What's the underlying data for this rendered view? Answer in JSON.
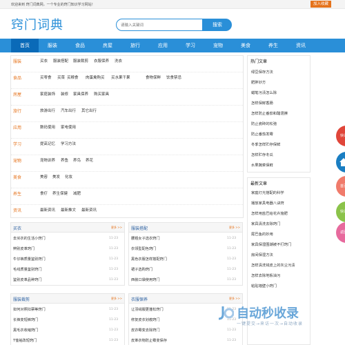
{
  "topbar": {
    "welcome": "欢迎来到 窍门词典网，一个专业的窍门知识学习网站！",
    "favorite": "加入收藏"
  },
  "logo": "窍门词典",
  "search": {
    "placeholder": "请输入关键词",
    "button": "搜索"
  },
  "nav": [
    "首页",
    "服装",
    "食品",
    "房屋",
    "旅行",
    "应用",
    "学习",
    "宠物",
    "美食",
    "养生",
    "资讯"
  ],
  "categories": [
    {
      "name": "服装",
      "items": [
        "买衣",
        "服装搭配",
        "服装裁剪",
        "衣服保养",
        "洗衣"
      ]
    },
    {
      "name": "食品",
      "items": [
        "买零食",
        "买菜",
        "买粮食",
        "肉蛋禽购买",
        "买水果干果",
        "食物保鲜",
        "饮食禁忌"
      ]
    },
    {
      "name": "房屋",
      "items": [
        "家庭装饰",
        "装修",
        "家具保养",
        "购买家具"
      ]
    },
    {
      "name": "旅行",
      "items": [
        "旅游出行",
        "汽车出行",
        "其它出行"
      ]
    },
    {
      "name": "应用",
      "items": [
        "数码使用",
        "家电使用"
      ]
    },
    {
      "name": "学习",
      "items": [
        "提高记忆",
        "学习方法"
      ]
    },
    {
      "name": "宠物",
      "items": [
        "宠物训养",
        "养鱼",
        "养鸟",
        "养花"
      ]
    },
    {
      "name": "美食",
      "items": [
        "美容",
        "美发",
        "化妆"
      ]
    },
    {
      "name": "养生",
      "items": [
        "食疗",
        "养生保健",
        "减肥"
      ]
    },
    {
      "name": "资讯",
      "items": [
        "最新资讯",
        "最新推文",
        "最新资讯"
      ]
    }
  ],
  "hot": {
    "title": "热门文章",
    "items": [
      "绿豆保存方法",
      "肥胖妙方",
      "蜡笔污渍怎么除",
      "怎样保鲜香肠",
      "怎样防止番茄和醋混擦",
      "防止瓷砖的松弛",
      "防止番茄发霉",
      "冬季怎样贮存保鲜",
      "怎样贮存冬瓜",
      "水果蔬菜保鲜"
    ]
  },
  "latest": {
    "title": "最新文章",
    "items": [
      "家庭灯光搭配的科学",
      "播放家具电器八诀窍",
      "怎样用盐巴给花卉施肥",
      "家具清洗去除窍门",
      "尾巴鱼的妙用",
      "家具保湿围潮被不打窍门",
      "房间保湿方法",
      "怎样清洗钱皮上的灰尘污渍",
      "怎样去除地板油污",
      "粘贴墙壁小窍门"
    ]
  },
  "boxes": [
    {
      "title": "买衣",
      "more": "更多 >>",
      "rows": [
        {
          "t": "去买衣的生活小窍门",
          "d": "11-23"
        },
        {
          "t": "辨别皮革窍门",
          "d": "11-23"
        },
        {
          "t": "牛仔裤质量鉴别窍门",
          "d": "11-23"
        },
        {
          "t": "毛线质量鉴别窍门",
          "d": "11-23"
        },
        {
          "t": "鉴别皮革品种窍门",
          "d": "11-23"
        }
      ]
    },
    {
      "title": "服装搭配",
      "more": "更多 >>",
      "rows": [
        {
          "t": "腰粗女子选衣窍门",
          "d": "11-23"
        },
        {
          "t": "衣领型配色窍门",
          "d": "11-23"
        },
        {
          "t": "黑色衣服怎样搭配窍门",
          "d": "11-23"
        },
        {
          "t": "裙子选购窍门",
          "d": "11-23"
        },
        {
          "t": "西装口袋使用窍门",
          "d": "11-23"
        }
      ]
    },
    {
      "title": "服装裁剪",
      "more": "更多 >>",
      "rows": [
        {
          "t": "如何对照扣票等窍门",
          "d": "11-23"
        },
        {
          "t": "长裤变短裤窍门",
          "d": "11-23"
        },
        {
          "t": "黑毛衣收缩窍门",
          "d": "11-23"
        },
        {
          "t": "T恤袖改短窍门",
          "d": "11-23"
        }
      ]
    },
    {
      "title": "衣服保养",
      "more": "更多 >>",
      "rows": [
        {
          "t": "让羽绒服更蓬松窍门",
          "d": "11-23"
        },
        {
          "t": "修复皮衣划痕窍门",
          "d": "11-23"
        },
        {
          "t": "皮衣霉变去除窍门",
          "d": "11-23"
        },
        {
          "t": "皮革衣物防止霉变保存",
          "d": "11-23"
        }
      ]
    }
  ],
  "floats": [
    "快讯",
    "",
    "首页",
    "快讯",
    "返回"
  ],
  "watermark": {
    "brand": "自动秒收录",
    "tagline": "一键提交→来访一次→自动收录"
  }
}
